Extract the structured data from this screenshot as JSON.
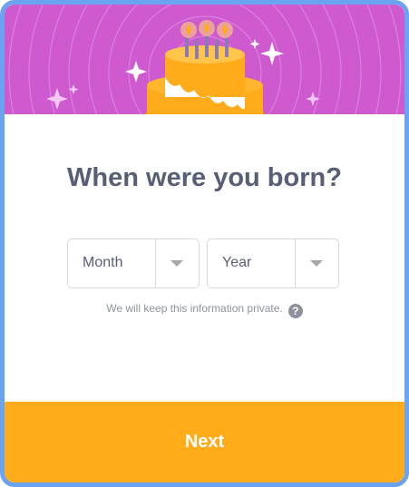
{
  "dialog": {
    "title": "When were you born?",
    "month_select": {
      "selected": "Month"
    },
    "year_select": {
      "selected": "Year"
    },
    "privacy_note": "We will keep this information private.",
    "help_icon_glyph": "?",
    "next_label": "Next"
  },
  "icons": {
    "banner": "birthday-cake-icon",
    "dropdown": "chevron-down-icon",
    "help": "question-circle-icon",
    "sparkle": "sparkle-icon"
  },
  "colors": {
    "frame_border": "#6aa3f0",
    "banner_background": "#cf5ad0",
    "title_text": "#575e75",
    "next_button": "#ffab1a",
    "cake": "#ffab1a",
    "frosting": "#ffffff"
  }
}
